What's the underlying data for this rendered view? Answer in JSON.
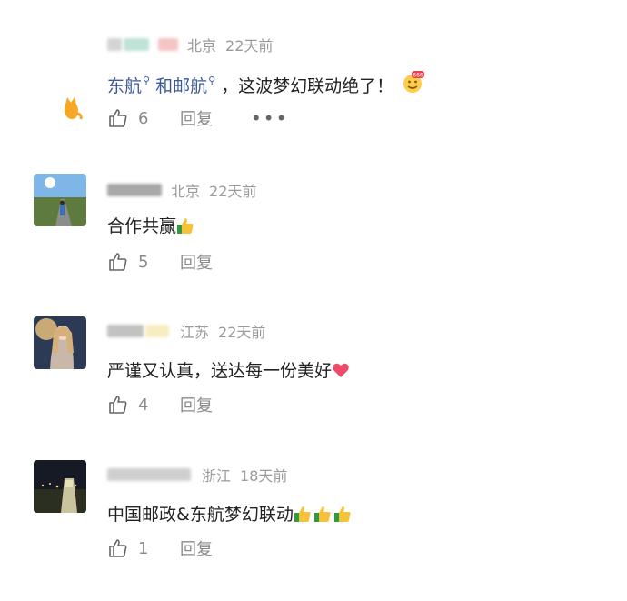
{
  "comments": [
    {
      "location": "北京",
      "time": "22天前",
      "text_parts": [
        "东航",
        "和邮航",
        "，这波梦幻联动绝了！"
      ],
      "likes": "6",
      "reply_label": "回复",
      "more_label": "•••"
    },
    {
      "location": "北京",
      "time": "22天前",
      "text": "合作共赢",
      "likes": "5",
      "reply_label": "回复"
    },
    {
      "location": "江苏",
      "time": "22天前",
      "text": "严谨又认真，送达每一份美好",
      "likes": "4",
      "reply_label": "回复"
    },
    {
      "location": "浙江",
      "time": "18天前",
      "text": "中国邮政&东航梦幻联动",
      "likes": "1",
      "reply_label": "回复"
    }
  ],
  "colors": {
    "link": "#3c5a99",
    "meta": "#9a9a9a",
    "text": "#222222",
    "action": "#8a8a8a"
  },
  "icons": [
    "thumbs-up-icon",
    "thumbs-up-emoji-icon",
    "heart-emoji-icon",
    "666-emoji-icon",
    "search-mag-icon"
  ]
}
